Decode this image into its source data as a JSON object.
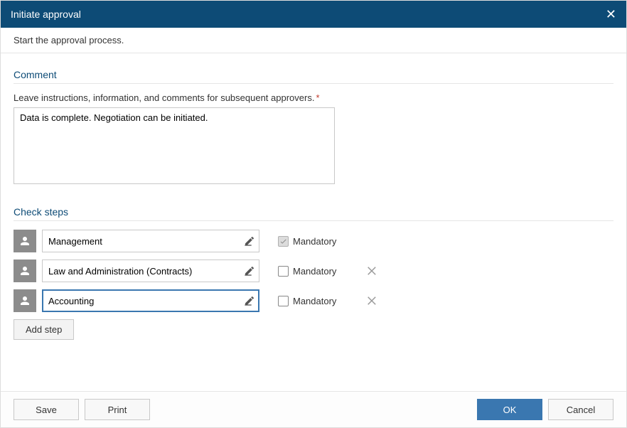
{
  "dialog": {
    "title": "Initiate approval",
    "subtitle": "Start the approval process."
  },
  "comment_section": {
    "title": "Comment",
    "label": "Leave instructions, information, and comments for subsequent approvers.",
    "required_marker": "*",
    "value": "Data is complete. Negotiation can be initiated."
  },
  "steps_section": {
    "title": "Check steps",
    "mandatory_label": "Mandatory",
    "steps": [
      {
        "value": "Management",
        "mandatory": true,
        "locked": true,
        "deletable": false,
        "active": false
      },
      {
        "value": "Law and Administration (Contracts)",
        "mandatory": false,
        "locked": false,
        "deletable": true,
        "active": false
      },
      {
        "value": "Accounting",
        "mandatory": false,
        "locked": false,
        "deletable": true,
        "active": true
      }
    ],
    "add_button": "Add step"
  },
  "footer": {
    "save": "Save",
    "print": "Print",
    "ok": "OK",
    "cancel": "Cancel"
  }
}
